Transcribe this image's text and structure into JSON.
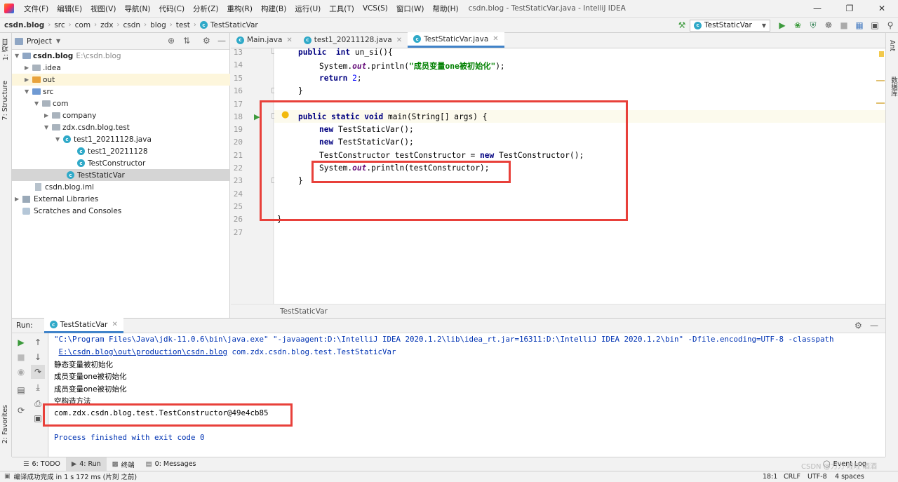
{
  "menubar": {
    "items": [
      "文件(F)",
      "编辑(E)",
      "视图(V)",
      "导航(N)",
      "代码(C)",
      "分析(Z)",
      "重构(R)",
      "构建(B)",
      "运行(U)",
      "工具(T)",
      "VCS(S)",
      "窗口(W)",
      "帮助(H)"
    ],
    "title": "csdn.blog - TestStaticVar.java - IntelliJ IDEA"
  },
  "breadcrumb": [
    "csdn.blog",
    "src",
    "com",
    "zdx",
    "csdn",
    "blog",
    "test",
    "TestStaticVar"
  ],
  "run_config": "TestStaticVar",
  "left_stripe": {
    "project_tab": "1: 项目",
    "structure_tab": "7: Structure",
    "favorites_tab": "2: Favorites"
  },
  "right_stripe": {
    "ant_tab": "Ant",
    "database_tab": "数据库"
  },
  "project_panel": {
    "header": "Project",
    "tree": [
      {
        "label": "csdn.blog",
        "hint": "E:\\csdn.blog"
      },
      {
        "label": ".idea"
      },
      {
        "label": "out"
      },
      {
        "label": "src"
      },
      {
        "label": "com"
      },
      {
        "label": "company"
      },
      {
        "label": "zdx.csdn.blog.test"
      },
      {
        "label": "test1_20211128.java"
      },
      {
        "label": "test1_20211128"
      },
      {
        "label": "TestConstructor"
      },
      {
        "label": "TestStaticVar"
      },
      {
        "label": "csdn.blog.iml"
      },
      {
        "label": "External Libraries"
      },
      {
        "label": "Scratches and Consoles"
      }
    ]
  },
  "editor_tabs": [
    "Main.java",
    "test1_20211128.java",
    "TestStaticVar.java"
  ],
  "line_numbers": [
    "13",
    "14",
    "15",
    "16",
    "17",
    "18",
    "19",
    "20",
    "21",
    "22",
    "23",
    "24",
    "25",
    "26",
    "27"
  ],
  "code": {
    "l13_kw": "public",
    "l13_type": "int",
    "l13_rest": "un_si(){",
    "l14_a": "System.",
    "l14_b": "out",
    "l14_c": ".println(",
    "l14_str": "\"成员变量one被初始化\"",
    "l14_d": ");",
    "l15_kw": "return",
    "l15_num": "2",
    "l15_end": ";",
    "l16": "}",
    "l18_kw": "public static void",
    "l18_rest": "main(String[] args) {",
    "l19_kw": "new",
    "l19_rest": "TestStaticVar();",
    "l20_kw": "new",
    "l20_rest": "TestStaticVar();",
    "l21_a": "TestConstructor testConstructor = ",
    "l21_kw": "new",
    "l21_b": "TestConstructor();",
    "l22_a": "System.",
    "l22_b": "out",
    "l22_c": ".println(testConstructor);",
    "l23": "}",
    "l26": "}"
  },
  "editor_breadcrumb": "TestStaticVar",
  "run_panel": {
    "label": "Run:",
    "tab": "TestStaticVar"
  },
  "console": {
    "cmd1": "\"C:\\Program Files\\Java\\jdk-11.0.6\\bin\\java.exe\" \"-javaagent:D:\\IntelliJ IDEA 2020.1.2\\lib\\idea_rt.jar=16311:D:\\IntelliJ IDEA 2020.1.2\\bin\" -Dfile.encoding=UTF-8 -classpath",
    "cmd2_link": "E:\\csdn.blog\\out\\production\\csdn.blog",
    "cmd2_rest": " com.zdx.csdn.blog.test.TestStaticVar",
    "out1": "静态变量被初始化",
    "out2": "成员变量one被初始化",
    "out3": "成员变量one被初始化",
    "out4": "空构造方法",
    "out5": "com.zdx.csdn.blog.test.TestConstructor@49e4cb85",
    "finished": "Process finished with exit code 0"
  },
  "bottom_tabs": [
    "6: TODO",
    "4: Run",
    "终端",
    "0: Messages"
  ],
  "event_log": "Event Log",
  "status": {
    "message": "编译成功完成 in 1 s 172 ms (片刻 之前)",
    "position": "18:1",
    "line_sep": "CRLF",
    "encoding": "UTF-8",
    "indent": "4 spaces",
    "watermark": "CSDN @力力·睦睦·酒酒"
  },
  "colors": {
    "highlight_box": "#e8403a",
    "accent": "#4083c9"
  }
}
